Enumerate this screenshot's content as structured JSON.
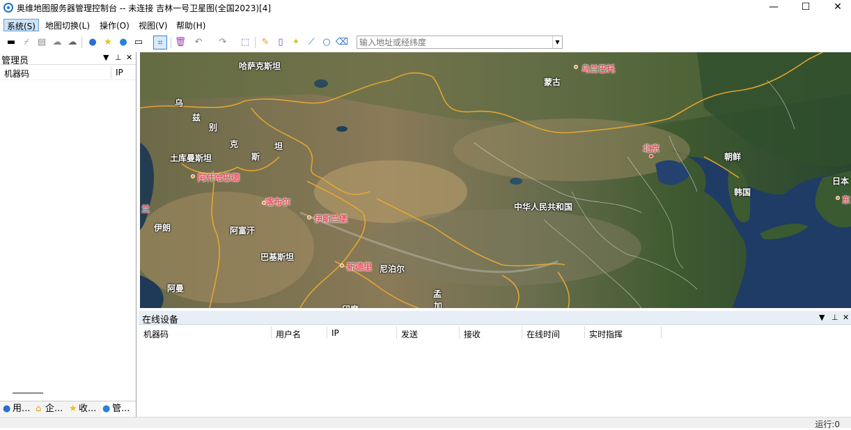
{
  "window": {
    "title": "奥维地图服务器管理控制台 -- 未连接  吉林一号卫星图(全国2023)[4]",
    "min": "—",
    "max": "☐",
    "close": "✕"
  },
  "menu": [
    {
      "label": "系统(S)"
    },
    {
      "label": "地图切换(L)"
    },
    {
      "label": "操作(O)"
    },
    {
      "label": "视图(V)"
    },
    {
      "label": "帮助(H)"
    }
  ],
  "toolbar": {
    "address_placeholder": "输入地址或经纬度",
    "icons": [
      "layout-icon",
      "line-icon",
      "list-icon",
      "cloud-upload-icon",
      "cloud-icon",
      "user-icon",
      "star-icon",
      "person-icon",
      "device-icon",
      "crop-icon",
      "delete-icon",
      "undo-icon",
      "redo-icon",
      "select-rect-icon",
      "pen-icon",
      "ruler-icon",
      "star-edit-icon",
      "polyline-icon",
      "circle-icon",
      "eraser-icon"
    ]
  },
  "left_panel": {
    "title": "管理员",
    "columns": [
      "机器码",
      "IP"
    ],
    "tabs": [
      {
        "label": "用...",
        "icon": "user-icon"
      },
      {
        "label": "企...",
        "icon": "company-icon"
      },
      {
        "label": "收...",
        "icon": "star-icon"
      },
      {
        "label": "管...",
        "icon": "admin-icon"
      }
    ]
  },
  "map_labels": {
    "kazakhstan": "哈萨克斯坦",
    "ulaanbaatar": "乌兰巴托",
    "mongolia": "蒙古",
    "wu": "乌",
    "zi": "兹",
    "bie": "别",
    "ke": "克",
    "si": "斯",
    "tan": "坦",
    "turkmenistan": "土库曼斯坦",
    "ashgabat": "阿什哈巴德",
    "beijing": "北京",
    "korea_north": "朝鲜",
    "korea_south": "韩国",
    "japan": "日本",
    "dong": "东",
    "lan": "兰",
    "kabul": "喀布尔",
    "iran": "伊朗",
    "afghanistan": "阿富汗",
    "islamabad": "伊斯兰堡",
    "china": "中华人民共和国",
    "pakistan": "巴基斯坦",
    "newdelhi": "新德里",
    "nepal": "尼泊尔",
    "oman": "阿曼",
    "meng": "孟",
    "jia": "加",
    "yindu_partial": "印度"
  },
  "device_panel": {
    "title": "在线设备",
    "columns": [
      "机器码",
      "用户名",
      "IP",
      "发送",
      "接收",
      "在线时间",
      "实时指挥"
    ]
  },
  "status": {
    "running": "运行:0"
  }
}
